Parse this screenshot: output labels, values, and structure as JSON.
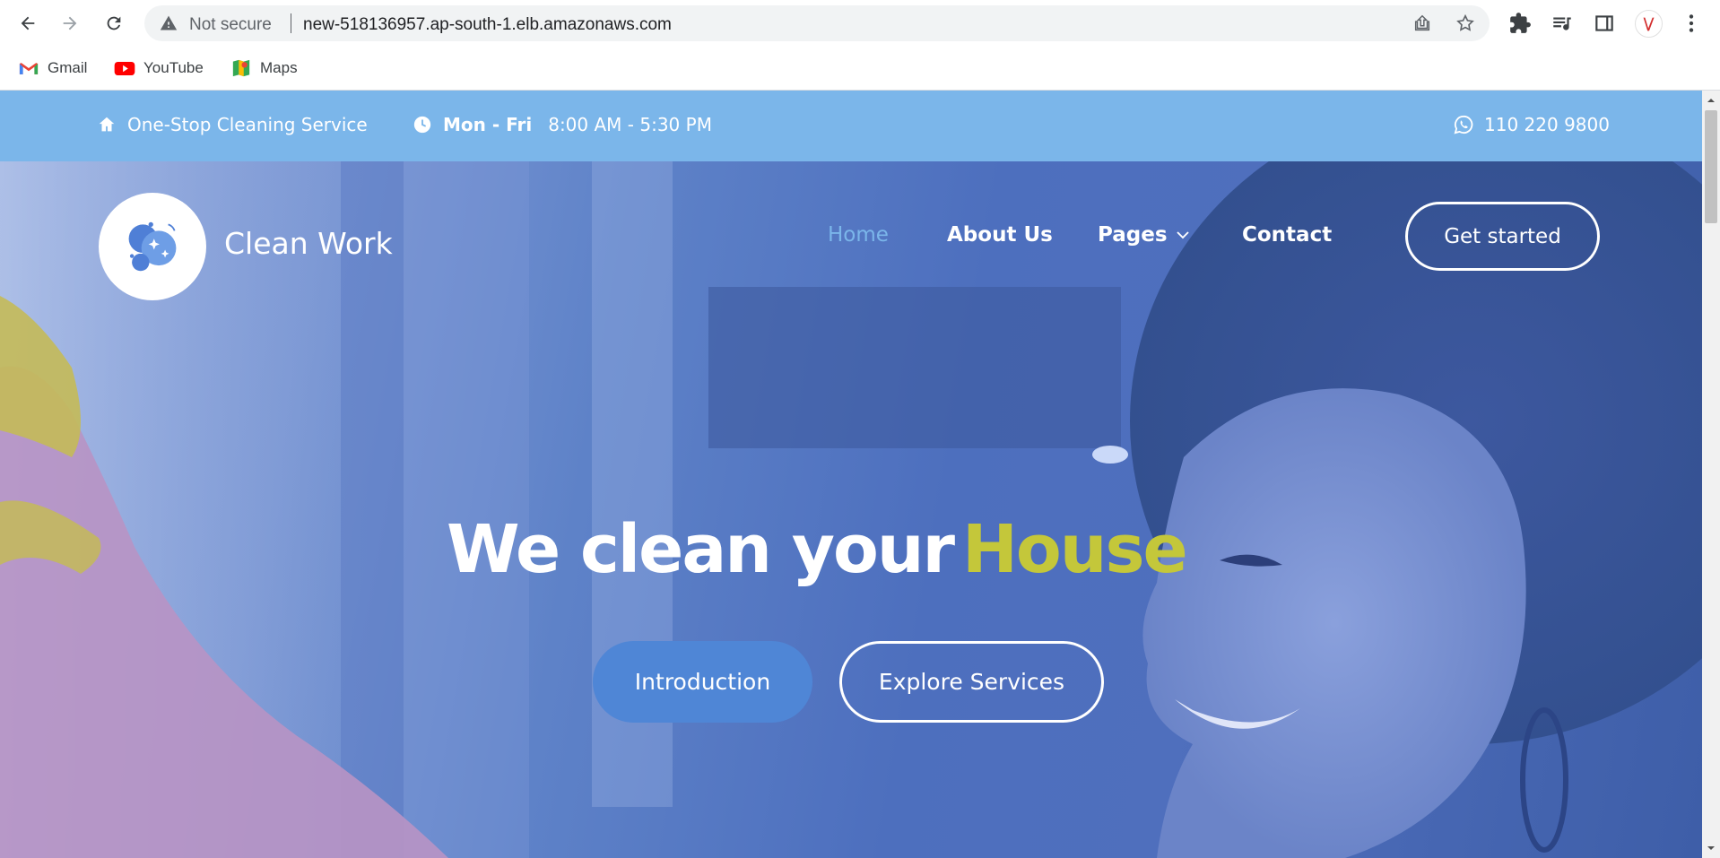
{
  "browser": {
    "security_label": "Not secure",
    "url": "new-518136957.ap-south-1.elb.amazonaws.com",
    "bookmarks": [
      {
        "label": "Gmail",
        "icon": "gmail-icon"
      },
      {
        "label": "YouTube",
        "icon": "youtube-icon"
      },
      {
        "label": "Maps",
        "icon": "maps-icon"
      }
    ]
  },
  "topbar": {
    "service": "One-Stop Cleaning Service",
    "days": "Mon - Fri",
    "hours": "8:00 AM - 5:30 PM",
    "phone": "110 220 9800"
  },
  "header": {
    "brand": "Clean Work",
    "nav": [
      "Home",
      "About Us",
      "Pages",
      "Contact"
    ],
    "active_nav": "Home",
    "cta": "Get started"
  },
  "hero": {
    "headline": "We clean your",
    "headline_highlight": "House",
    "primary_button": "Introduction",
    "secondary_button": "Explore Services"
  },
  "colors": {
    "topbar": "#7bb6ea",
    "highlight": "#c4c73a",
    "primary_button": "#4f86d6"
  }
}
